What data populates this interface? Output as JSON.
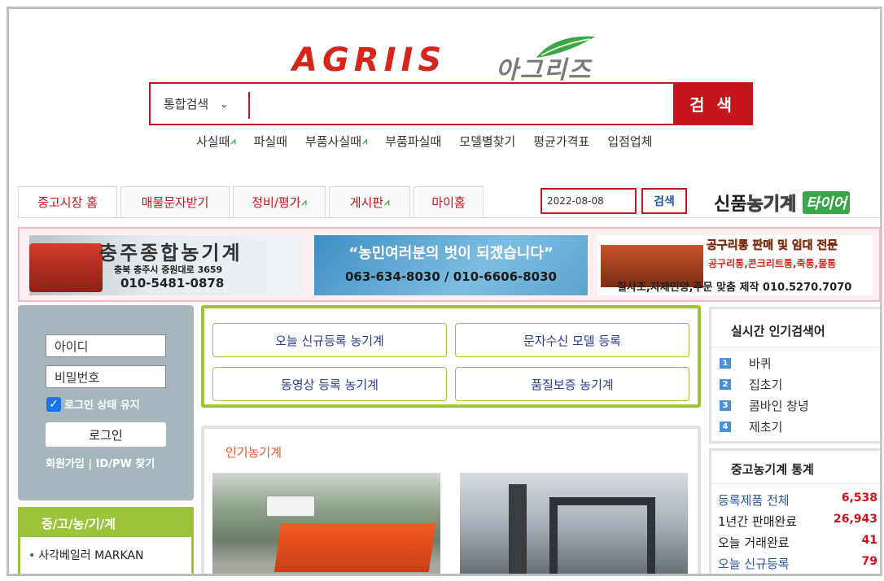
{
  "logo": {
    "letters": "AGRIIS",
    "korean": "아그리즈"
  },
  "search": {
    "scope": "통합검색",
    "value": "",
    "button": "검 색"
  },
  "quick_links": [
    "사실때",
    "파실때",
    "부품사실때",
    "부품파실때",
    "모델별찾기",
    "평균가격표",
    "입점업체"
  ],
  "tabs": [
    "중고시장 홈",
    "매물문자받기",
    "정비/평가",
    "게시판",
    "마이홈"
  ],
  "date_search": {
    "date": "2022-08-08",
    "button": "검색"
  },
  "new_machine": {
    "label1": "신품",
    "label2": "농기계",
    "label3": "타이어"
  },
  "banners": {
    "b1": {
      "title": "충주종합농기계",
      "address": "충북 충주시 중원대로 3659",
      "phone": "010-5481-0878"
    },
    "b2": {
      "slogan": "“농민여러분의 벗이 되겠습니다”",
      "phone": "063-634-8030 / 010-6606-8030"
    },
    "b3": {
      "title": "공구리통 판매 및 임대 전문",
      "subtitle": "공구리통,콘크리트통,죽통,물통",
      "footer": "칠사조,자제인양,주문 맞춤 제작  010.5270.7070"
    }
  },
  "login": {
    "id_placeholder": "아이디",
    "pw_placeholder": "비밀번호",
    "keep_label": "로그인 상태 유지",
    "login_button": "로그인",
    "join_links": "회원가입 | ID/PW 찾기"
  },
  "used_list": {
    "header": "중/고/농/기/계",
    "items": [
      "사각베일러 MARKAN"
    ]
  },
  "menu_buttons": [
    "오늘 신규등록 농기계",
    "문자수신 모델 등록",
    "동영상 등록 농기계",
    "품질보증 농기계"
  ],
  "popular": {
    "header": "인기농기계"
  },
  "trending": {
    "header": "실시간 인기검색어",
    "items": [
      {
        "rank": "1",
        "term": "바퀴"
      },
      {
        "rank": "2",
        "term": "집초기"
      },
      {
        "rank": "3",
        "term": "콤바인 창녕"
      },
      {
        "rank": "4",
        "term": "제초기"
      }
    ]
  },
  "stats": {
    "header": "중고농기계 통계",
    "rows": [
      {
        "label": "등록제품 전체",
        "value": "6,538"
      },
      {
        "label": "1년간 판매완료",
        "value": "26,943"
      },
      {
        "label": "오늘 거래완료",
        "value": "41"
      },
      {
        "label": "오늘 신규등록",
        "value": "79"
      }
    ]
  },
  "colors": {
    "brand_red": "#c4161c",
    "accent_green": "#9cc33a",
    "link_blue": "#2a55a3"
  }
}
